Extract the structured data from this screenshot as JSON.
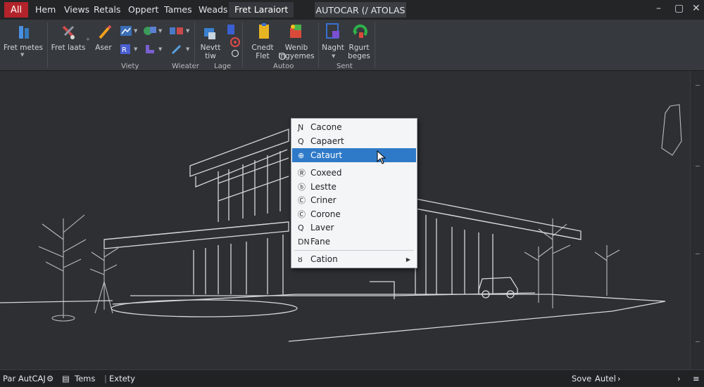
{
  "menubar": {
    "all_label": "All",
    "tabs": [
      "Hem",
      "Views",
      "Retals",
      "Oppert",
      "Tames",
      "Weads",
      "Fret Laraiort"
    ],
    "app_title": "AUTOCAR (/ ATOLAS"
  },
  "ribbon": {
    "buttons": {
      "fret_metes": "Fret metes",
      "fret_laats": "Fret laats",
      "aser": "Aser",
      "needs": "Nevtt",
      "needs2": "tiw",
      "cnedt": "Cnedt",
      "cnedt2": "Flet",
      "wenib": "Wenib",
      "wenib2": "Ingyemes",
      "naght": "Naght",
      "rgurf": "Rgurt",
      "rgurf2": "beges"
    },
    "groups": [
      "Viety",
      "Wieater",
      "Lage",
      "Autoo",
      "Sent"
    ]
  },
  "context_menu": {
    "items": [
      {
        "icon": "Ɲ",
        "label": "Cacone"
      },
      {
        "icon": "Q",
        "label": "Capaert"
      },
      {
        "icon": "⊕",
        "label": "Cataurt"
      },
      {
        "icon": "Ⓡ",
        "label": "Coxeed"
      },
      {
        "icon": "ⓑ",
        "label": "Lestte"
      },
      {
        "icon": "Ⓒ",
        "label": "Criner"
      },
      {
        "icon": "Ⓒ",
        "label": "Corone"
      },
      {
        "icon": "Q",
        "label": "Laver"
      },
      {
        "icon": "DN",
        "label": "Fane"
      },
      {
        "icon": "ȣ",
        "label": "Cation"
      }
    ],
    "selected_index": 2
  },
  "statusbar": {
    "app": "Par AutCAJ",
    "tems": "Tems",
    "extety": "Extety",
    "sove": "Sove",
    "autel": "Autel"
  },
  "colors": {
    "accent_red": "#b3232a",
    "selection_blue": "#2f7ac8",
    "canvas_bg": "#2d2f32"
  }
}
